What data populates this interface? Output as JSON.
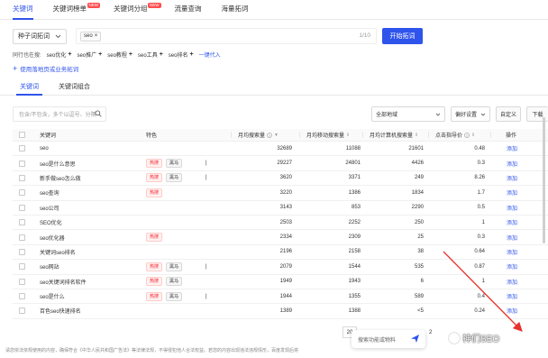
{
  "topnav": {
    "tabs": [
      {
        "label": "关键词",
        "active": true,
        "badge": ""
      },
      {
        "label": "关键词榜单",
        "active": false,
        "badge": "NEW"
      },
      {
        "label": "关键词分组",
        "active": false,
        "badge": "NEW"
      },
      {
        "label": "流量查询",
        "active": false,
        "badge": ""
      },
      {
        "label": "海量拓词",
        "active": false,
        "badge": ""
      }
    ]
  },
  "search": {
    "mode_select": "种子词拓词",
    "chip": "seo",
    "count": "1/10",
    "start_button": "开始拓词"
  },
  "peers": {
    "label": "同行也在搜:",
    "items": [
      "seo优化",
      "seo推广",
      "seo教程",
      "seo工具",
      "seo排名"
    ],
    "add_all": "一键代入"
  },
  "landing_link": "使用落地页或业务拓词",
  "subtabs": [
    {
      "label": "关键词",
      "active": true
    },
    {
      "label": "关键词组合",
      "active": false
    }
  ],
  "toolbar": {
    "filter_placeholder": "包含/不包含，多个以逗号、分隔",
    "region": "全部地域",
    "preference": "偏好设置",
    "custom": "自定义",
    "download": "下载"
  },
  "table": {
    "headers": {
      "keyword": "关键词",
      "feature": "特色",
      "monthly": "月均搜索量",
      "mobile": "月均移动搜索量",
      "pc": "月均计算机搜索量",
      "cpc": "点击指导价",
      "op": "操作"
    },
    "rows": [
      {
        "kw": "seo",
        "hot": false,
        "dark": false,
        "bar": "",
        "mon": "32689",
        "mob": "11088",
        "pc": "21601",
        "cpc": "0.48",
        "op": "添加"
      },
      {
        "kw": "seo是什么意思",
        "hot": true,
        "dark": true,
        "bar": "|",
        "mon": "29227",
        "mob": "24801",
        "pc": "4426",
        "cpc": "0.3",
        "op": "添加"
      },
      {
        "kw": "新手做seo怎么做",
        "hot": true,
        "dark": true,
        "bar": "|",
        "mon": "3620",
        "mob": "3371",
        "pc": "249",
        "cpc": "8.26",
        "op": "添加"
      },
      {
        "kw": "seo查询",
        "hot": true,
        "dark": false,
        "bar": "",
        "mon": "3220",
        "mob": "1386",
        "pc": "1834",
        "cpc": "1.7",
        "op": "添加"
      },
      {
        "kw": "seo公司",
        "hot": false,
        "dark": false,
        "bar": "",
        "mon": "3143",
        "mob": "853",
        "pc": "2290",
        "cpc": "0.5",
        "op": "添加"
      },
      {
        "kw": "SEO优化",
        "hot": false,
        "dark": false,
        "bar": "",
        "mon": "2503",
        "mob": "2252",
        "pc": "250",
        "cpc": "1",
        "op": "添加"
      },
      {
        "kw": "seo优化器",
        "hot": true,
        "dark": false,
        "bar": "",
        "mon": "2334",
        "mob": "2309",
        "pc": "25",
        "cpc": "0.3",
        "op": "添加"
      },
      {
        "kw": "关键词seo排名",
        "hot": false,
        "dark": false,
        "bar": "",
        "mon": "2196",
        "mob": "2158",
        "pc": "38",
        "cpc": "0.64",
        "op": "添加"
      },
      {
        "kw": "seo网站",
        "hot": true,
        "dark": true,
        "bar": "|",
        "mon": "2079",
        "mob": "1544",
        "pc": "535",
        "cpc": "0.87",
        "op": "添加"
      },
      {
        "kw": "seo关键词排名软件",
        "hot": true,
        "dark": true,
        "bar": "",
        "mon": "1949",
        "mob": "1943",
        "pc": "6",
        "cpc": "1",
        "op": "添加"
      },
      {
        "kw": "seo是什么",
        "hot": true,
        "dark": true,
        "bar": "|",
        "mon": "1944",
        "mob": "1355",
        "pc": "589",
        "cpc": "0.4",
        "op": "添加"
      },
      {
        "kw": "百色seo快速排名",
        "hot": false,
        "dark": false,
        "bar": "",
        "mon": "1389",
        "mob": "1388",
        "pc": "<5",
        "cpc": "0.24",
        "op": "添加"
      }
    ]
  },
  "pager": {
    "size": "20",
    "page": "2"
  },
  "ai_box": {
    "placeholder": "搜索功能或物料"
  },
  "footer": "请您依法依规使用的内容，确保符合《中华人民共和国广告法》等法律法规，不得侵犯他人合法权益。若您的内容出现违法违规情形，百度发现后将",
  "watermark": "神们SEO"
}
